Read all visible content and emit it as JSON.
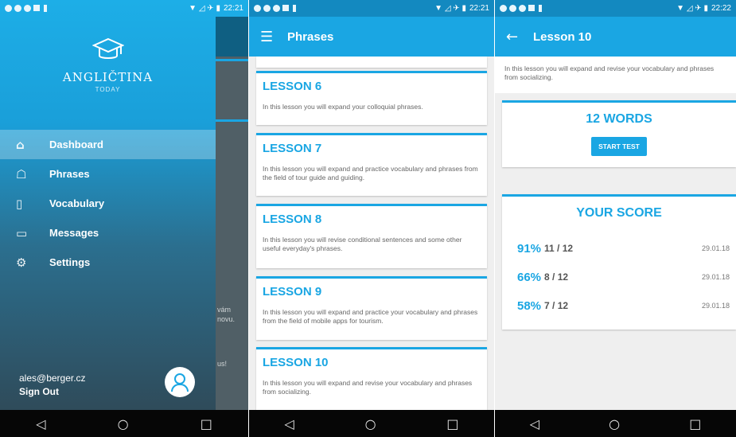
{
  "colors": {
    "accent": "#1aa6e3",
    "navbar": "#060606",
    "background": "#efefef"
  },
  "status_bar": [
    {
      "time": "22:21"
    },
    {
      "time": "22:21"
    },
    {
      "time": "22:22"
    }
  ],
  "nav_icons": [
    "back-triangle-icon",
    "home-circle-icon",
    "recents-square-icon"
  ],
  "drawer": {
    "brand": "ANGLIČTINA",
    "brand_sub": "TODAY",
    "items": [
      {
        "label": "Dashboard",
        "icon": "house-icon",
        "active": true
      },
      {
        "label": "Phrases",
        "icon": "chat-board-icon",
        "active": false
      },
      {
        "label": "Vocabulary",
        "icon": "book-icon",
        "active": false
      },
      {
        "label": "Messages",
        "icon": "message-icon",
        "active": false
      },
      {
        "label": "Settings",
        "icon": "gear-icon",
        "active": false
      }
    ],
    "email": "ales@berger.cz",
    "sign_out": "Sign Out",
    "behind_fragments": [
      "vám",
      "novu.",
      "us!"
    ]
  },
  "phrases": {
    "title": "Phrases",
    "lessons": [
      {
        "title": "LESSON 6",
        "description": "In this lesson you will expand your colloquial phrases."
      },
      {
        "title": "LESSON 7",
        "description": "In this lesson you will expand and practice vocabulary and phrases from the field of tour guide and guiding."
      },
      {
        "title": "LESSON 8",
        "description": "In this lesson you will revise conditional sentences and some other useful everyday's phrases."
      },
      {
        "title": "LESSON 9",
        "description": "In this lesson you will expand and practice your vocabulary and phrases from the field of mobile apps for tourism."
      },
      {
        "title": "LESSON 10",
        "description": "In this lesson you will expand and revise your vocabulary and phrases from socializing."
      }
    ]
  },
  "lesson_detail": {
    "title": "Lesson 10",
    "description": "In this lesson you will expand and revise your vocabulary and phrases from socializing.",
    "word_count": "12 WORDS",
    "start_test": "START TEST",
    "score_heading": "YOUR SCORE",
    "scores": [
      {
        "percent": "91%",
        "count": "11 / 12",
        "date": "29.01.18"
      },
      {
        "percent": "66%",
        "count": "8 / 12",
        "date": "29.01.18"
      },
      {
        "percent": "58%",
        "count": "7 / 12",
        "date": "29.01.18"
      }
    ]
  }
}
